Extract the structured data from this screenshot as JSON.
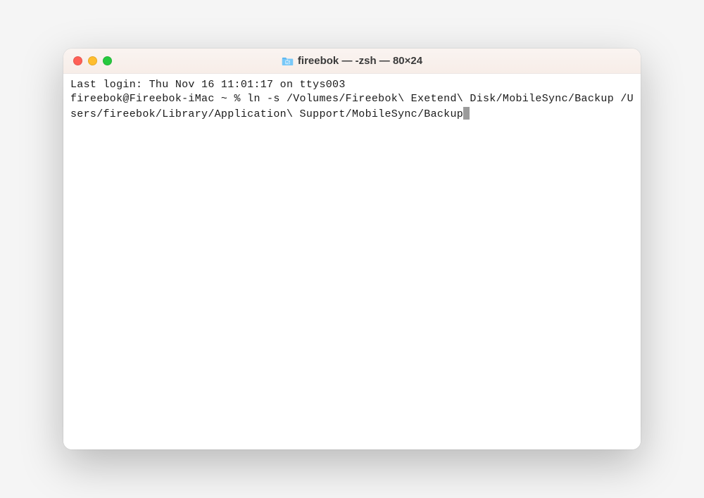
{
  "window": {
    "title": "fireebok — -zsh — 80×24",
    "traffic_lights": {
      "close": "close",
      "minimize": "minimize",
      "zoom": "zoom"
    }
  },
  "terminal": {
    "last_login_line": "Last login: Thu Nov 16 11:01:17 on ttys003",
    "prompt": "fireebok@Fireebok-iMac ~ % ",
    "command": "ln -s /Volumes/Fireebok\\ Exetend\\ Disk/MobileSync/Backup /Users/fireebok/Library/Application\\ Support/MobileSync/Backup"
  }
}
